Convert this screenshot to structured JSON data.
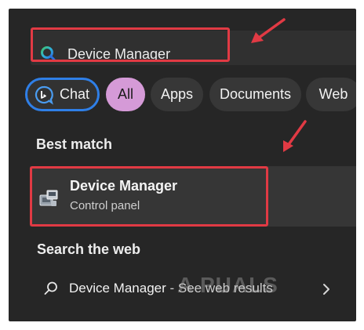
{
  "search": {
    "value": "Device Manager"
  },
  "filters": [
    {
      "label": "Chat"
    },
    {
      "label": "All"
    },
    {
      "label": "Apps"
    },
    {
      "label": "Documents"
    },
    {
      "label": "Web"
    }
  ],
  "best_match": {
    "heading": "Best match",
    "title": "Device Manager",
    "subtitle": "Control panel"
  },
  "web": {
    "heading": "Search the web",
    "query": "Device Manager",
    "suffix": " - See web results"
  },
  "watermark": "A PUALS",
  "colors": {
    "panel_bg": "#262626",
    "highlight": "#e13a44",
    "chat_border": "#2f7fe7",
    "all_chip": "#d59ad7",
    "selection_accent": "#4aa0ef"
  },
  "icons": [
    "search-logo-icon",
    "bing-chat-icon",
    "device-manager-icon",
    "search-icon",
    "chevron-right-icon",
    "red-arrow-icon"
  ]
}
